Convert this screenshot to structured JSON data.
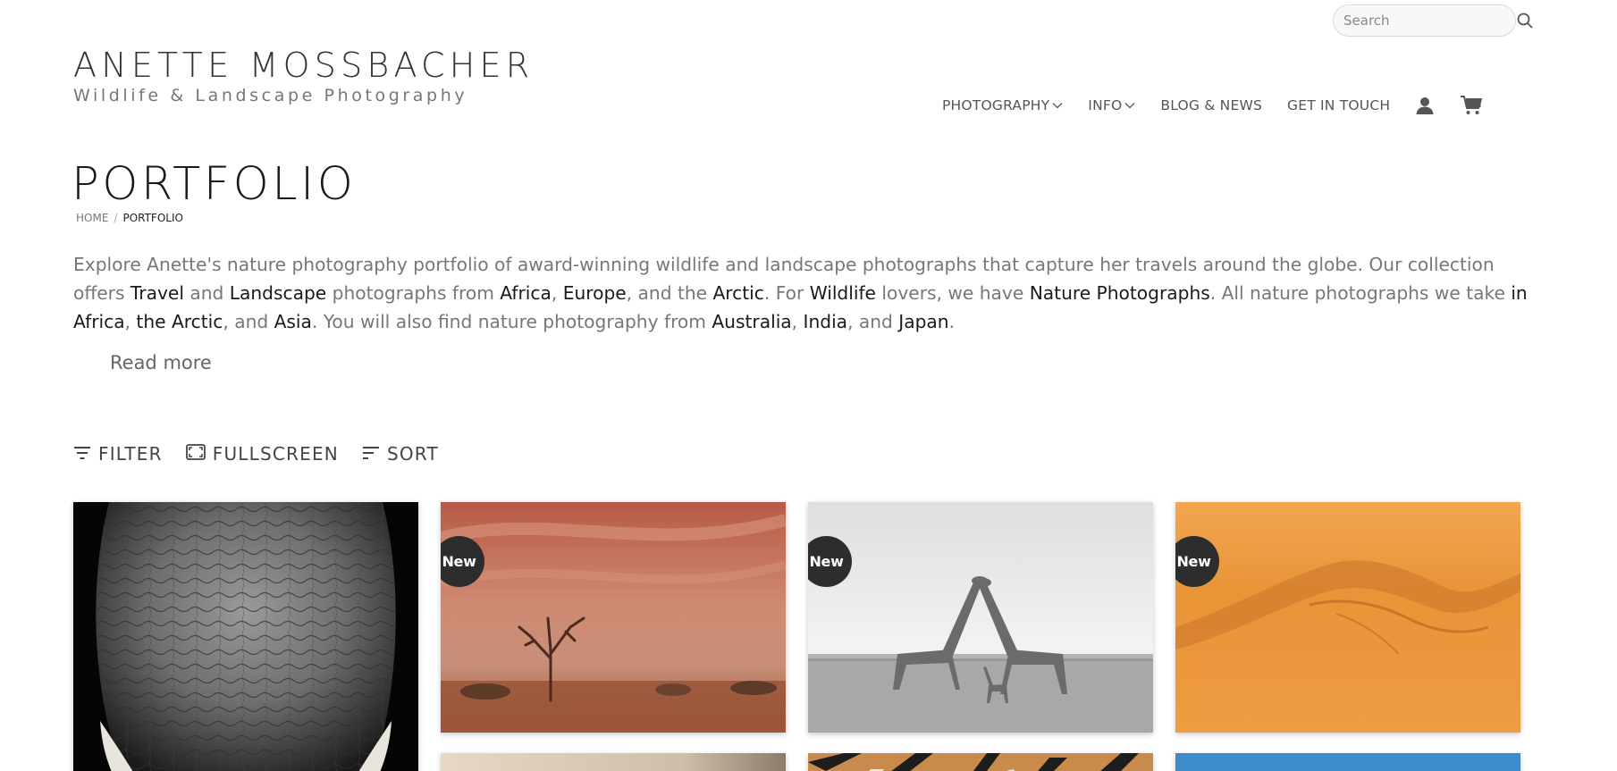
{
  "search": {
    "placeholder": "Search"
  },
  "brand": {
    "name": "ANETTE MOSSBACHER",
    "tagline": "Wildlife & Landscape Photography"
  },
  "nav": {
    "items": [
      {
        "label": "PHOTOGRAPHY",
        "has_dropdown": true
      },
      {
        "label": "INFO",
        "has_dropdown": true
      },
      {
        "label": "BLOG & NEWS",
        "has_dropdown": false
      },
      {
        "label": "GET IN TOUCH",
        "has_dropdown": false
      }
    ],
    "icons": [
      "user-icon",
      "cart-icon"
    ]
  },
  "page": {
    "title": "PORTFOLIO",
    "breadcrumb": {
      "home": "HOME",
      "separator": "/",
      "current": "PORTFOLIO"
    }
  },
  "intro": {
    "t01": "Explore Anette's nature photography portfolio of award-winning wildlife and landscape photographs that capture her travels around the globe. Our collection offers ",
    "l01": "Travel",
    "t02": " and ",
    "l02": "Landscape",
    "t03": " photographs from ",
    "l03": "Africa",
    "t04": ", ",
    "l04": "Europe",
    "t05": ", and the ",
    "l05": "Arctic",
    "t06": ". For ",
    "l06": "Wildlife",
    "t07": " lovers, we have ",
    "l07": "Nature Photographs",
    "t08": ". All nature photographs we take ",
    "l08": "in Africa",
    "t09": ", ",
    "l09": "the Arctic",
    "t10": ", and ",
    "l10": "Asia",
    "t11": ". You will also find nature photography from ",
    "l11": "Australia",
    "t12": ", ",
    "l12": "India",
    "t13": ", and ",
    "l13": "Japan",
    "t14": "."
  },
  "read_more": "Read more",
  "toolbar": {
    "filter": "FILTER",
    "fullscreen": "FULLSCREEN",
    "sort": "SORT"
  },
  "gallery": {
    "badge_label": "New",
    "items": [
      {
        "subject": "elephant skin black and white",
        "is_new": false
      },
      {
        "subject": "dead tree in red desert dust",
        "is_new": true
      },
      {
        "subject": "giraffes black and white",
        "is_new": true
      },
      {
        "subject": "orange sand dune",
        "is_new": true
      },
      {
        "subject": "beige abstract",
        "is_new": false
      },
      {
        "subject": "tiger fur",
        "is_new": false
      },
      {
        "subject": "blue sky",
        "is_new": false
      }
    ]
  },
  "colors": {
    "text": "#555555",
    "link": "#1a1a1a",
    "badge": "#2d2d2d",
    "muted_text": "#777777"
  }
}
